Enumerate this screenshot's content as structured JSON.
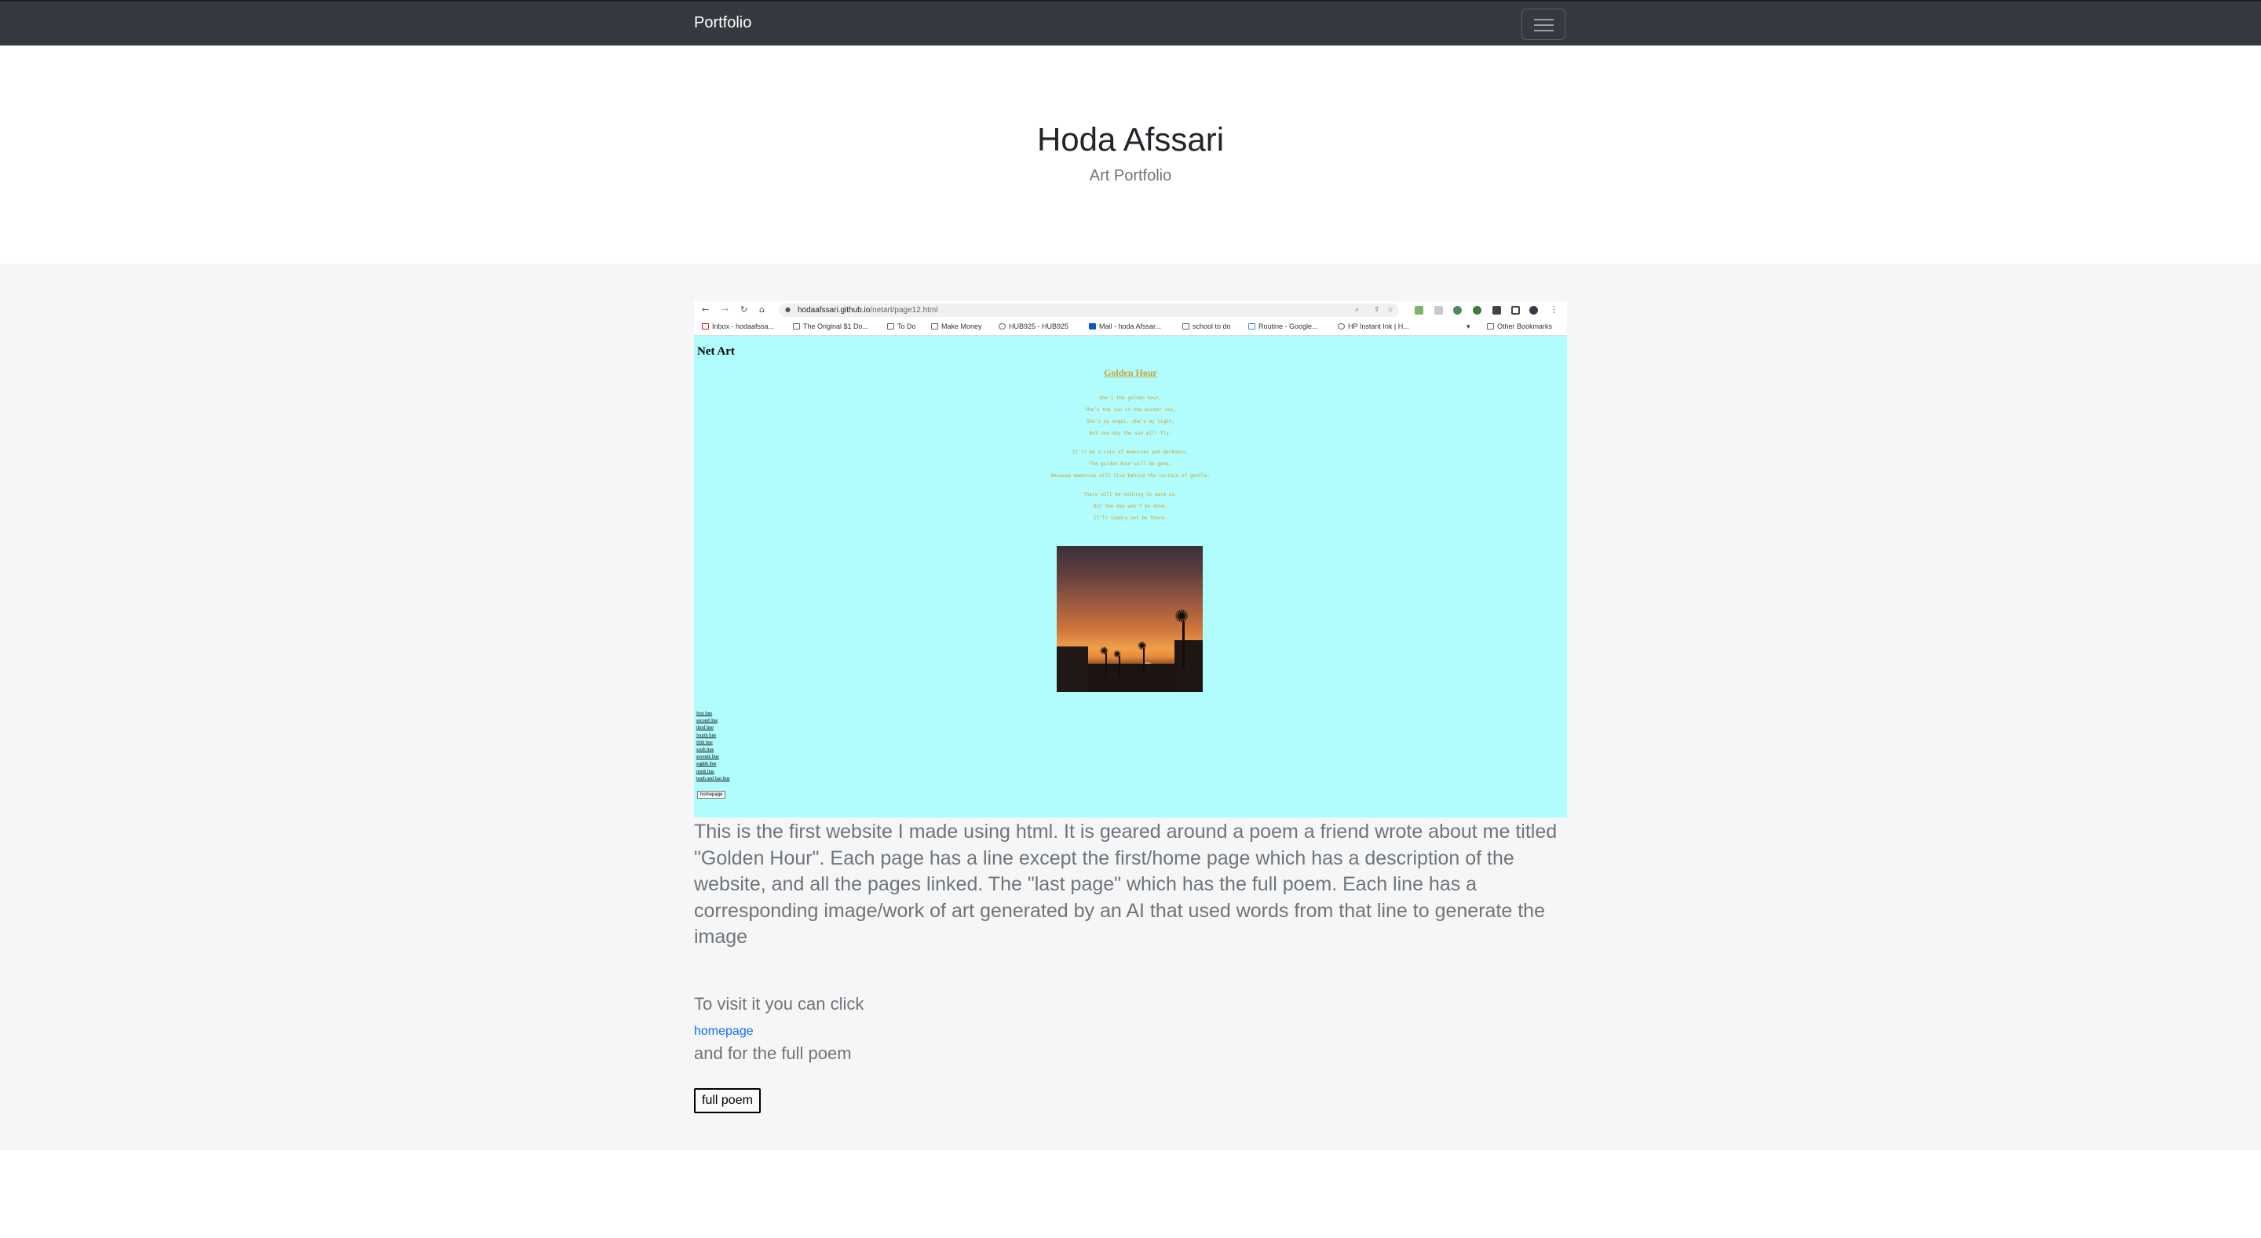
{
  "navbar": {
    "brand": "Portfolio",
    "menu_icon": "hamburger-icon"
  },
  "header": {
    "title": "Hoda Afssari",
    "subtitle": "Art Portfolio"
  },
  "screenshot": {
    "browser": {
      "url_host": "hodaafssari.github.io",
      "url_path": "/netart/page12.html",
      "bookmarks": [
        "Inbox - hodaafssa...",
        "The Original $1 Do...",
        "To Do",
        "Make Money",
        "HUB925 - HUB925",
        "Mail - hoda Afssar...",
        "school to do",
        "Routine - Google...",
        "HP Instant Ink | H...",
        "Other Bookmarks"
      ]
    },
    "page": {
      "heading": "Net Art",
      "poem_title": "Golden Hour",
      "poem_lines": [
        "She's the golden hour,",
        "She's the sun in the winter sky,",
        "She's my angel, she's my light,",
        "But one day the sun will fly.",
        "It'll be a rain of memories and darkness,",
        "The golden hour will be gone,",
        "Because memories will live behind the curtain of gentle.",
        "There will be nothing to warm us,",
        "But the day won't be done,",
        "It'll simply not be there."
      ],
      "nav_links": [
        "first line",
        "second line",
        "third line",
        "fourth line",
        "fifth line",
        "sixth line",
        "seventh line",
        "eighth line",
        "ninth line",
        "tenth and last line"
      ],
      "homepage_button": "homepage"
    }
  },
  "description": "This is the first website I made using html. It is geared around a poem a friend wrote about me titled \"Golden Hour\". Each page has a line except the first/home page which has a description of the website, and all the pages linked. The \"last page\" which has the full poem. Each line has a corresponding image/work of art generated by an AI that used words from that line to generate the image",
  "visit_text": "To visit it you can click",
  "homepage_link": "homepage",
  "full_poem_text": "and for the full poem",
  "full_poem_button": "full poem",
  "colors": {
    "navbar": "#343a40",
    "section_bg": "#f6f6f6",
    "shot_page_bg": "#b1fcfc",
    "poem_text": "#c9a23a",
    "link": "#0d6efd"
  }
}
